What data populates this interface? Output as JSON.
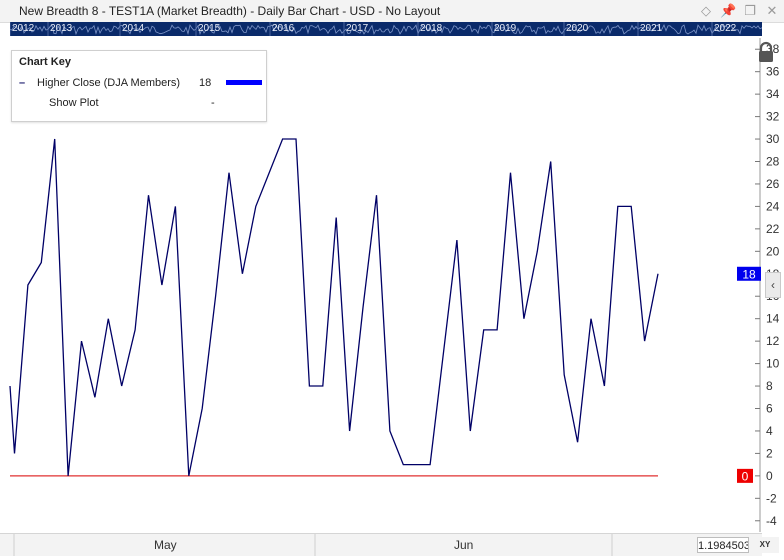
{
  "window": {
    "title": "New Breadth 8 - TEST1A (Market Breadth) - Daily Bar Chart - USD - No Layout",
    "icons": [
      "diamond-icon",
      "pin-icon",
      "restore-icon",
      "close-icon"
    ]
  },
  "timeline": {
    "years": [
      "2012",
      "2013",
      "2014",
      "2015",
      "2016",
      "2017",
      "2018",
      "2019",
      "2020",
      "2021",
      "2022"
    ]
  },
  "chart_key": {
    "title": "Chart Key",
    "series_name": "Higher Close (DJA Members)",
    "series_value": "18",
    "show_plot_label": "Show Plot",
    "show_plot_value": "-",
    "colors": {
      "series_swatch": "#0000ff"
    }
  },
  "x_axis": {
    "months": [
      "May",
      "Jun"
    ]
  },
  "status": {
    "price_readout": "1.1984503",
    "xy_label": "XY"
  },
  "chart_data": {
    "type": "line",
    "title": "",
    "xlabel": "",
    "ylabel": "",
    "series": [
      {
        "name": "Higher Close (DJA Members)",
        "color": "#000066",
        "values": [
          8,
          2,
          17,
          19,
          30,
          0,
          12,
          7,
          14,
          8,
          13,
          25,
          17,
          24,
          0,
          6,
          16,
          27,
          18,
          24,
          27,
          30,
          30,
          8,
          8,
          23,
          4,
          15,
          25,
          4,
          1,
          1,
          1,
          11,
          21,
          4,
          13,
          13,
          27,
          14,
          20,
          28,
          9,
          3,
          14,
          8,
          24,
          24,
          12,
          18
        ]
      }
    ],
    "x_positions": [
      0,
      1,
      4,
      7,
      10,
      13,
      16,
      19,
      22,
      25,
      28,
      31,
      34,
      37,
      40,
      43,
      46,
      49,
      52,
      55,
      58,
      61,
      64,
      67,
      70,
      73,
      76,
      79,
      82,
      85,
      88,
      91,
      94,
      97,
      100,
      103,
      106,
      109,
      112,
      115,
      118,
      121,
      124,
      127,
      130,
      133,
      136,
      139,
      142,
      145
    ],
    "ylim": [
      -5,
      39
    ],
    "y_ticks": [
      -4,
      -2,
      0,
      2,
      4,
      6,
      8,
      10,
      12,
      14,
      16,
      18,
      20,
      22,
      24,
      26,
      28,
      30,
      32,
      34,
      36,
      38
    ],
    "zero_line": {
      "value": 0,
      "color": "#e03030",
      "label": "0"
    },
    "last_value_label": {
      "value": 18,
      "label": "18",
      "color": "#0000ee"
    },
    "grid": false,
    "legend": "top-left"
  }
}
